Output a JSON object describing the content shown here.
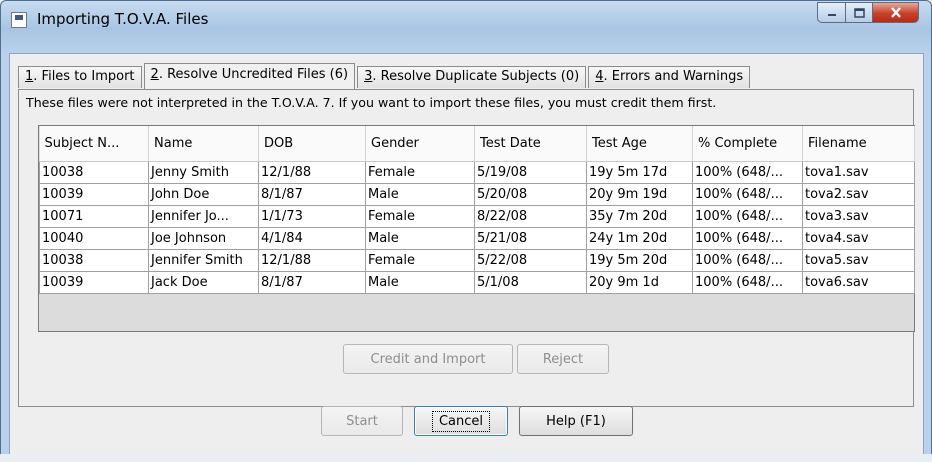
{
  "window": {
    "title": "Importing T.O.V.A. Files"
  },
  "tabs": [
    {
      "mnemonic": "1",
      "label": ". Files to Import"
    },
    {
      "mnemonic": "2",
      "label": ". Resolve Uncredited Files (6)"
    },
    {
      "mnemonic": "3",
      "label": ". Resolve Duplicate Subjects (0)"
    },
    {
      "mnemonic": "4",
      "label": ". Errors and Warnings"
    }
  ],
  "info_text": "These files were not interpreted in the T.O.V.A. 7. If you want to import these files, you must credit them first.",
  "table": {
    "columns": [
      "Subject N...",
      "Name",
      "DOB",
      "Gender",
      "Test Date",
      "Test Age",
      "% Complete",
      "Filename"
    ],
    "rows": [
      [
        "10038",
        "Jenny Smith",
        "12/1/88",
        "Female",
        "5/19/08",
        "19y 5m 17d",
        "100% (648/...",
        "tova1.sav"
      ],
      [
        "10039",
        "John Doe",
        "8/1/87",
        "Male",
        "5/20/08",
        "20y 9m 19d",
        "100% (648/...",
        "tova2.sav"
      ],
      [
        "10071",
        "Jennifer Jo...",
        "1/1/73",
        "Female",
        "8/22/08",
        "35y 7m 20d",
        "100% (648/...",
        "tova3.sav"
      ],
      [
        "10040",
        "Joe Johnson",
        "4/1/84",
        "Male",
        "5/21/08",
        "24y 1m 20d",
        "100% (648/...",
        "tova4.sav"
      ],
      [
        "10038",
        "Jennifer Smith",
        "12/1/88",
        "Female",
        "5/22/08",
        "19y 5m 20d",
        "100% (648/...",
        "tova5.sav"
      ],
      [
        "10039",
        "Jack Doe",
        "8/1/87",
        "Male",
        "5/1/08",
        "20y 9m 1d",
        "100% (648/...",
        "tova6.sav"
      ]
    ]
  },
  "buttons": {
    "credit_import": "Credit and Import",
    "reject": "Reject",
    "start": "Start",
    "cancel": "Cancel",
    "help": "Help (F1)"
  },
  "icons": {
    "app": "window-app-icon",
    "minimize": "minimize-icon",
    "maximize": "maximize-icon",
    "close": "close-icon"
  }
}
